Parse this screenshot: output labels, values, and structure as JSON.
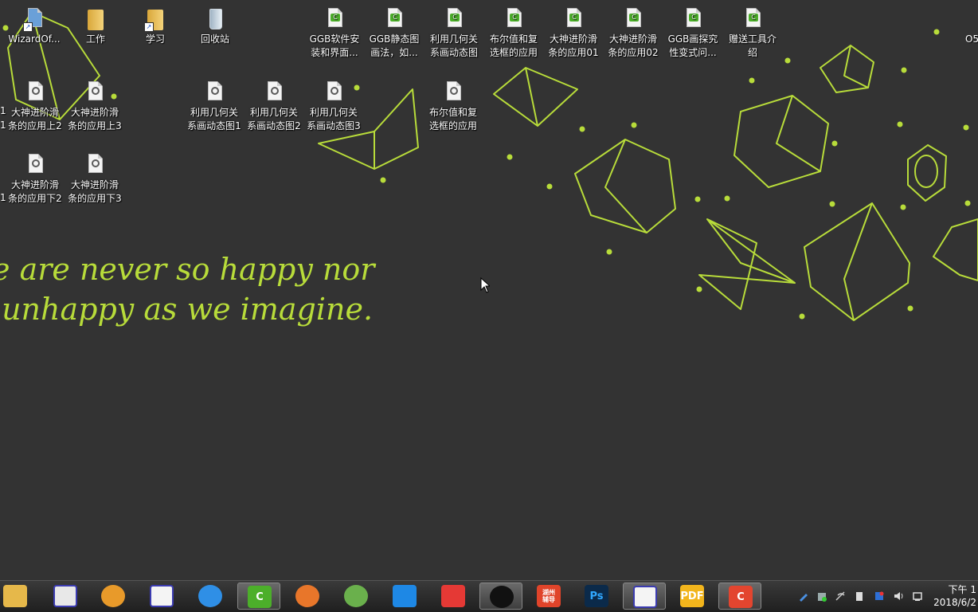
{
  "desktop": {
    "icons": [
      {
        "label": "WizardOf...",
        "type": "app",
        "name": "wizardof-icon"
      },
      {
        "label": "工作",
        "type": "folder",
        "name": "folder-work-icon"
      },
      {
        "label": "学习",
        "type": "folder-shortcut",
        "name": "folder-study-icon"
      },
      {
        "label": "回收站",
        "type": "bin",
        "name": "recycle-bin-icon"
      },
      {
        "label": "GGB软件安\n装和界面...",
        "type": "camtasia",
        "name": "video-file-icon"
      },
      {
        "label": "GGB静态图\n画法，如...",
        "type": "camtasia",
        "name": "video-file-icon"
      },
      {
        "label": "利用几何关\n系画动态图",
        "type": "camtasia",
        "name": "video-file-icon"
      },
      {
        "label": "布尔值和复\n选框的应用",
        "type": "camtasia",
        "name": "video-file-icon"
      },
      {
        "label": "大神进阶滑\n条的应用01",
        "type": "camtasia",
        "name": "video-file-icon"
      },
      {
        "label": "大神进阶滑\n条的应用02",
        "type": "camtasia",
        "name": "video-file-icon"
      },
      {
        "label": "GGB画探究\n性变式问...",
        "type": "camtasia",
        "name": "video-file-icon"
      },
      {
        "label": "赠送工具介\n绍",
        "type": "camtasia",
        "name": "video-file-icon"
      },
      {
        "label": "大神进阶滑\n条的应用上2",
        "type": "ggb",
        "name": "ggb-file-icon"
      },
      {
        "label": "大神进阶滑\n条的应用上3",
        "type": "ggb",
        "name": "ggb-file-icon"
      },
      {
        "label": "利用几何关\n系画动态图1",
        "type": "ggb",
        "name": "ggb-file-icon"
      },
      {
        "label": "利用几何关\n系画动态图2",
        "type": "ggb",
        "name": "ggb-file-icon"
      },
      {
        "label": "利用几何关\n系画动态图3",
        "type": "ggb",
        "name": "ggb-file-icon"
      },
      {
        "label": "布尔值和复\n选框的应用",
        "type": "ggb",
        "name": "ggb-file-icon"
      },
      {
        "label": "大神进阶滑\n条的应用下2",
        "type": "ggb",
        "name": "ggb-file-icon"
      },
      {
        "label": "大神进阶滑\n条的应用下3",
        "type": "ggb",
        "name": "ggb-file-icon"
      }
    ],
    "edge_fragments": [
      "1",
      "1",
      "1",
      "O5"
    ],
    "wallpaper_quote": "e are never so happy nor\n unhappy as we imagine.",
    "accent_color": "#b8dc3a",
    "background_color": "#333333"
  },
  "taskbar": {
    "buttons": [
      {
        "app": "Windows Explorer",
        "icon": "explorer-folder-icon",
        "text": ""
      },
      {
        "app": "Recorder",
        "icon": "record-icon",
        "text": ""
      },
      {
        "app": "Paint",
        "icon": "palette-icon",
        "text": ""
      },
      {
        "app": "GeoGebra",
        "icon": "geogebra-icon",
        "text": ""
      },
      {
        "app": "Feishu",
        "icon": "bird-icon",
        "text": ""
      },
      {
        "app": "Camtasia",
        "icon": "camtasia-icon",
        "text": "C"
      },
      {
        "app": "Browser",
        "icon": "orange-bird-icon",
        "text": ""
      },
      {
        "app": "Globe",
        "icon": "globe-icon",
        "text": ""
      },
      {
        "app": "Star",
        "icon": "star-icon",
        "text": ""
      },
      {
        "app": "XMind",
        "icon": "xmind-icon",
        "text": ""
      },
      {
        "app": "Keyhole",
        "icon": "keyhole-icon",
        "text": ""
      },
      {
        "app": "湖州辅导",
        "icon": "red-app-icon",
        "text": "湖州\n辅导"
      },
      {
        "app": "Photoshop",
        "icon": "photoshop-icon",
        "text": "Ps"
      },
      {
        "app": "GeoGebra 2",
        "icon": "geogebra-icon",
        "text": ""
      },
      {
        "app": "PDF",
        "icon": "pdf-icon",
        "text": "PDF"
      },
      {
        "app": "Camtasia Recorder",
        "icon": "camtasia-red-icon",
        "text": "C"
      }
    ],
    "active_indices": [
      5,
      10,
      13,
      15
    ],
    "clock": {
      "line1": "下午 1",
      "line2": "2018/6/2"
    }
  }
}
